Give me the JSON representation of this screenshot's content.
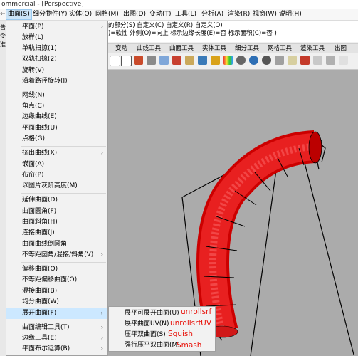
{
  "window": {
    "title": "ommercial - [Perspective]"
  },
  "menubar": {
    "items": [
      "曲面(S)",
      "细分物件(Y)",
      "实体(O)",
      "网格(M)",
      "出图(D)",
      "变动(T)",
      "工具(L)",
      "分析(A)",
      "渲染(R)",
      "视窗(W)",
      "说明(H)"
    ],
    "app_prefix": "←"
  },
  "left_stub": {
    "lines": [
      "告",
      "令",
      "准"
    ]
  },
  "command_line": {
    "line1": "的部分(S) 自定义(C) 自定义(R) 自定义(O)",
    "line2": ")=软性  外侧(O)=向上  标示边缘长度(E)=否  标示面积(C)=否 )"
  },
  "toolbar_tabs": [
    "变动",
    "曲线工具",
    "曲面工具",
    "实体工具",
    "细分工具",
    "网格工具",
    "渲染工具",
    "出图"
  ],
  "surface_menu": {
    "items": [
      {
        "label": "平面(P)",
        "arrow": "›"
      },
      {
        "label": "放样(L)",
        "arrow": ""
      },
      {
        "label": "单轨扫掠(1)",
        "arrow": ""
      },
      {
        "label": "双轨扫掠(2)",
        "arrow": ""
      },
      {
        "label": "旋转(V)",
        "arrow": ""
      },
      {
        "label": "沿着路径旋转(I)",
        "arrow": ""
      },
      {
        "label": "网线(N)",
        "arrow": ""
      },
      {
        "label": "角点(C)",
        "arrow": ""
      },
      {
        "label": "边缘曲线(E)",
        "arrow": ""
      },
      {
        "label": "平面曲线(U)",
        "arrow": ""
      },
      {
        "label": "点格(G)",
        "arrow": ""
      },
      {
        "label": "挤出曲线(X)",
        "arrow": "›"
      },
      {
        "label": "嵌面(A)",
        "arrow": ""
      },
      {
        "label": "布帘(P)",
        "arrow": ""
      },
      {
        "label": "以图片灰阶高度(M)",
        "arrow": ""
      },
      {
        "label": "延伸曲面(D)",
        "arrow": ""
      },
      {
        "label": "曲面圆角(F)",
        "arrow": ""
      },
      {
        "label": "曲面斜角(H)",
        "arrow": ""
      },
      {
        "label": "连接曲面(J)",
        "arrow": ""
      },
      {
        "label": "曲面曲线倒圆角",
        "arrow": ""
      },
      {
        "label": "不等距圆角/混接/斜角(V)",
        "arrow": "›"
      },
      {
        "label": "偏移曲面(O)",
        "arrow": ""
      },
      {
        "label": "不等距偏移曲面(O)",
        "arrow": ""
      },
      {
        "label": "混接曲面(B)",
        "arrow": ""
      },
      {
        "label": "均分曲面(W)",
        "arrow": ""
      },
      {
        "label": "展开曲面(F)",
        "arrow": "›"
      },
      {
        "label": "曲面编辑工具(T)",
        "arrow": "›"
      },
      {
        "label": "边缘工具(E)",
        "arrow": "›"
      },
      {
        "label": "平面布尔运算(B)",
        "arrow": "›"
      }
    ]
  },
  "submenu": {
    "items": [
      {
        "label": "展平可展开曲面(U)",
        "note": "unrollsrf"
      },
      {
        "label": "展平曲面UV(N)",
        "note": "unrollsrfUV"
      },
      {
        "label": "压平双曲面(S)",
        "note": "Squish"
      },
      {
        "label": "强行压平双曲面(M)",
        "note": "Smash"
      }
    ]
  },
  "colors": {
    "accent_note": "#e8140c",
    "tube": "#e01010",
    "highlight": "#cce8ff"
  }
}
